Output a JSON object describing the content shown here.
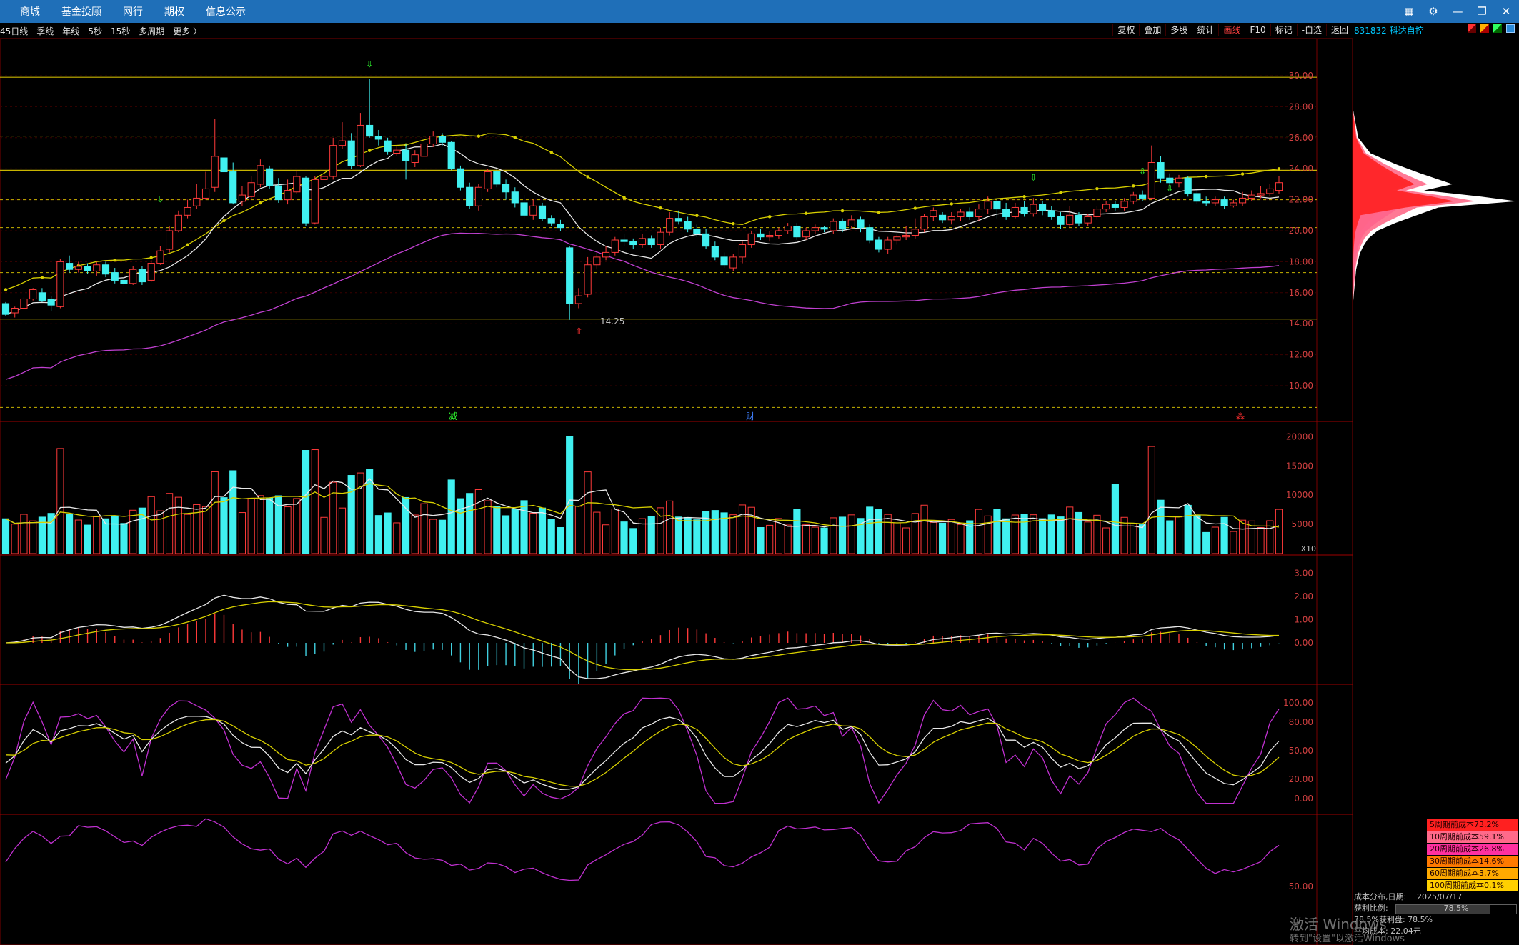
{
  "menu": [
    "商城",
    "基金投顾",
    "网行",
    "期权",
    "信息公示"
  ],
  "window_controls": [
    "▦",
    "⚙",
    "—",
    "❐",
    "✕"
  ],
  "periods": [
    "45日线",
    "季线",
    "年线",
    "5秒",
    "15秒",
    "多周期",
    "更多 〉"
  ],
  "tools": [
    "复权",
    "叠加",
    "多股",
    "统计",
    "画线",
    "F10",
    "标记",
    "-自选",
    "返回"
  ],
  "active_tool": "画线",
  "stock": {
    "label": "831832 科达自控"
  },
  "price_axis": {
    "ticks": [
      "30.00",
      "28.00",
      "26.00",
      "24.00",
      "22.00",
      "20.00",
      "18.00",
      "16.00",
      "14.00",
      "12.00",
      "10.00"
    ]
  },
  "low_label": "14.25",
  "event_markers": [
    {
      "text": "减"
    },
    {
      "text": "财"
    },
    {
      "text": "⁂"
    }
  ],
  "volume_axis": {
    "ticks": [
      "20000",
      "15000",
      "10000",
      "5000"
    ],
    "unit": "X10"
  },
  "macd_axis": {
    "ticks": [
      "3.00",
      "2.00",
      "1.00",
      "0.00"
    ]
  },
  "kdj_axis": {
    "ticks": [
      "100.00",
      "80.00",
      "50.00",
      "20.00",
      "0.00"
    ]
  },
  "wr_axis": {
    "ticks": [
      "50.00"
    ]
  },
  "cost_rows": [
    {
      "label": "5周期前成本73.2%",
      "color": "#ff2020"
    },
    {
      "label": "10周期前成本59.1%",
      "color": "#ff6a8a"
    },
    {
      "label": "20周期前成本26.8%",
      "color": "#ff30a0"
    },
    {
      "label": "30周期前成本14.6%",
      "color": "#ff7a00"
    },
    {
      "label": "60周期前成本3.7%",
      "color": "#ffaa00"
    },
    {
      "label": "100周期前成本0.1%",
      "color": "#ffd000"
    }
  ],
  "info": {
    "date_label": "成本分布,日期:",
    "date": "2025/07/17",
    "profit_label": "获利比例:",
    "profit_value": "78.5%",
    "profit_ratio": 0.785,
    "profit2_label": "78.5%获利盘:",
    "profit2_value": "78.5%",
    "avg_label": "平均成本:",
    "avg_value": "22.04元"
  },
  "watermark": {
    "line1": "激活 Windows",
    "line2": "转到\"设置\"以激活Windows"
  },
  "chart_data": {
    "type": "candlestick",
    "price_range": [
      8.5,
      31.5
    ],
    "h_levels_solid": [
      29.9,
      23.9,
      14.3
    ],
    "h_levels_dashed": [
      26.1,
      22.0,
      20.2,
      17.3,
      8.6
    ],
    "candles": [
      [
        15.3,
        14.6,
        15.4,
        14.5
      ],
      [
        14.7,
        15.0,
        15.1,
        14.4
      ],
      [
        15.0,
        15.6,
        15.7,
        14.9
      ],
      [
        15.6,
        16.2,
        16.3,
        15.5
      ],
      [
        16.0,
        15.5,
        16.3,
        15.4
      ],
      [
        15.6,
        15.2,
        15.8,
        14.8
      ],
      [
        15.1,
        18.0,
        18.2,
        15.0
      ],
      [
        17.9,
        17.5,
        18.4,
        17.3
      ],
      [
        17.5,
        17.7,
        18.0,
        17.3
      ],
      [
        17.7,
        17.4,
        17.9,
        17.2
      ],
      [
        17.4,
        17.8,
        18.0,
        17.1
      ],
      [
        17.8,
        17.2,
        18.0,
        17.0
      ],
      [
        17.3,
        16.8,
        17.6,
        16.6
      ],
      [
        16.8,
        16.6,
        17.0,
        16.4
      ],
      [
        16.6,
        17.5,
        17.7,
        16.5
      ],
      [
        17.5,
        16.7,
        17.7,
        16.5
      ],
      [
        16.8,
        17.9,
        18.1,
        16.7
      ],
      [
        17.9,
        18.7,
        19.0,
        17.8
      ],
      [
        18.8,
        20.0,
        20.3,
        18.6
      ],
      [
        20.0,
        21.0,
        21.3,
        19.9
      ],
      [
        21.0,
        21.5,
        22.0,
        20.8
      ],
      [
        21.6,
        22.1,
        23.0,
        21.4
      ],
      [
        22.1,
        22.7,
        23.8,
        22.0
      ],
      [
        22.8,
        24.8,
        27.2,
        22.5
      ],
      [
        24.7,
        23.8,
        25.0,
        23.4
      ],
      [
        23.8,
        21.8,
        24.4,
        21.7
      ],
      [
        21.9,
        22.3,
        22.9,
        21.6
      ],
      [
        22.2,
        23.1,
        23.5,
        22.0
      ],
      [
        23.0,
        24.2,
        24.6,
        22.8
      ],
      [
        24.0,
        22.9,
        24.2,
        22.7
      ],
      [
        22.9,
        22.0,
        23.4,
        21.8
      ],
      [
        22.0,
        22.6,
        23.3,
        21.7
      ],
      [
        22.5,
        23.5,
        23.9,
        22.4
      ],
      [
        23.4,
        20.5,
        23.5,
        20.3
      ],
      [
        20.5,
        23.3,
        23.5,
        20.4
      ],
      [
        23.3,
        23.5,
        23.8,
        22.8
      ],
      [
        23.5,
        25.5,
        26.0,
        23.3
      ],
      [
        25.5,
        25.8,
        27.0,
        25.3
      ],
      [
        25.8,
        24.2,
        26.3,
        24.0
      ],
      [
        24.2,
        26.8,
        27.6,
        24.1
      ],
      [
        26.8,
        26.1,
        29.8,
        26.0
      ],
      [
        26.1,
        25.9,
        26.5,
        25.5
      ],
      [
        25.8,
        25.1,
        26.0,
        24.9
      ],
      [
        25.0,
        25.2,
        25.5,
        24.8
      ],
      [
        25.2,
        24.5,
        25.6,
        23.3
      ],
      [
        24.4,
        24.9,
        25.2,
        24.1
      ],
      [
        24.8,
        25.6,
        25.9,
        24.6
      ],
      [
        25.6,
        26.1,
        26.4,
        25.4
      ],
      [
        26.1,
        25.7,
        26.3,
        25.5
      ],
      [
        25.7,
        24.0,
        25.8,
        23.9
      ],
      [
        24.0,
        22.8,
        24.2,
        22.6
      ],
      [
        22.8,
        21.6,
        23.1,
        21.4
      ],
      [
        21.6,
        22.8,
        23.0,
        21.3
      ],
      [
        22.7,
        23.8,
        24.0,
        22.5
      ],
      [
        23.8,
        23.0,
        24.0,
        22.8
      ],
      [
        23.0,
        22.5,
        23.3,
        22.0
      ],
      [
        22.5,
        21.8,
        22.8,
        21.5
      ],
      [
        21.8,
        21.0,
        22.3,
        20.8
      ],
      [
        21.0,
        21.6,
        22.0,
        20.7
      ],
      [
        21.6,
        20.8,
        21.8,
        20.6
      ],
      [
        20.8,
        20.5,
        21.0,
        20.3
      ],
      [
        20.4,
        20.2,
        20.7,
        20.0
      ],
      [
        18.9,
        15.3,
        19.0,
        14.25
      ],
      [
        15.3,
        15.8,
        16.3,
        15.0
      ],
      [
        15.9,
        17.8,
        18.3,
        15.7
      ],
      [
        17.8,
        18.3,
        18.6,
        17.5
      ],
      [
        18.3,
        18.6,
        19.0,
        18.1
      ],
      [
        18.6,
        19.4,
        19.6,
        18.4
      ],
      [
        19.4,
        19.3,
        19.8,
        19.0
      ],
      [
        19.3,
        19.1,
        19.5,
        18.8
      ],
      [
        19.1,
        19.5,
        19.8,
        18.9
      ],
      [
        19.5,
        19.1,
        19.7,
        18.9
      ],
      [
        19.1,
        19.9,
        20.2,
        18.8
      ],
      [
        19.9,
        20.8,
        21.2,
        19.7
      ],
      [
        20.8,
        20.6,
        21.3,
        20.4
      ],
      [
        20.6,
        20.1,
        20.9,
        19.9
      ],
      [
        20.1,
        19.8,
        20.4,
        19.6
      ],
      [
        19.8,
        19.0,
        20.1,
        18.8
      ],
      [
        19.0,
        18.3,
        19.3,
        18.1
      ],
      [
        18.3,
        17.8,
        18.6,
        17.6
      ],
      [
        17.6,
        18.3,
        18.5,
        17.4
      ],
      [
        18.3,
        19.1,
        19.3,
        17.9
      ],
      [
        19.1,
        19.8,
        20.0,
        18.9
      ],
      [
        19.8,
        19.6,
        20.1,
        19.4
      ],
      [
        19.6,
        19.7,
        20.0,
        19.3
      ],
      [
        19.7,
        20.0,
        20.2,
        19.5
      ],
      [
        20.0,
        20.3,
        20.5,
        19.8
      ],
      [
        20.3,
        19.6,
        20.5,
        19.4
      ],
      [
        19.6,
        20.0,
        20.2,
        19.4
      ],
      [
        20.0,
        20.2,
        20.4,
        19.8
      ],
      [
        20.2,
        20.1,
        20.3,
        19.9
      ],
      [
        20.0,
        20.6,
        20.8,
        19.8
      ],
      [
        20.6,
        20.1,
        20.8,
        19.9
      ],
      [
        20.3,
        20.7,
        21.0,
        20.1
      ],
      [
        20.7,
        20.2,
        20.9,
        19.9
      ],
      [
        20.2,
        19.4,
        20.4,
        19.2
      ],
      [
        19.4,
        18.8,
        19.6,
        18.6
      ],
      [
        18.8,
        19.4,
        19.6,
        18.5
      ],
      [
        19.4,
        19.6,
        19.8,
        19.1
      ],
      [
        19.6,
        19.7,
        20.3,
        19.4
      ],
      [
        19.7,
        20.1,
        20.8,
        19.5
      ],
      [
        20.1,
        20.9,
        21.1,
        19.9
      ],
      [
        20.9,
        21.3,
        21.5,
        20.6
      ],
      [
        21.0,
        20.7,
        21.2,
        20.5
      ],
      [
        20.7,
        20.9,
        21.2,
        20.4
      ],
      [
        20.9,
        21.2,
        21.4,
        20.6
      ],
      [
        21.2,
        20.9,
        21.5,
        20.7
      ],
      [
        20.9,
        21.4,
        21.7,
        20.6
      ],
      [
        21.4,
        21.9,
        22.2,
        21.1
      ],
      [
        21.9,
        21.4,
        22.1,
        20.8
      ],
      [
        21.4,
        20.9,
        21.8,
        20.7
      ],
      [
        20.9,
        21.5,
        21.8,
        20.8
      ],
      [
        21.5,
        21.1,
        21.9,
        20.9
      ],
      [
        21.1,
        21.7,
        22.1,
        20.9
      ],
      [
        21.7,
        21.3,
        21.9,
        21.0
      ],
      [
        21.3,
        20.9,
        21.6,
        20.7
      ],
      [
        20.9,
        20.4,
        21.2,
        20.1
      ],
      [
        20.4,
        21.0,
        21.6,
        20.2
      ],
      [
        21.0,
        20.5,
        21.2,
        20.3
      ],
      [
        20.5,
        20.9,
        21.1,
        20.3
      ],
      [
        20.9,
        21.4,
        21.6,
        20.7
      ],
      [
        21.4,
        21.7,
        21.9,
        21.2
      ],
      [
        21.7,
        21.5,
        21.9,
        21.3
      ],
      [
        21.5,
        21.9,
        22.1,
        21.3
      ],
      [
        21.9,
        22.3,
        22.5,
        21.7
      ],
      [
        22.3,
        22.1,
        22.6,
        21.9
      ],
      [
        22.1,
        24.4,
        25.5,
        22.0
      ],
      [
        24.4,
        23.4,
        24.8,
        23.1
      ],
      [
        23.4,
        23.1,
        23.7,
        22.9
      ],
      [
        23.1,
        23.4,
        23.6,
        22.8
      ],
      [
        23.4,
        22.4,
        23.5,
        22.2
      ],
      [
        22.4,
        21.9,
        22.6,
        21.7
      ],
      [
        21.9,
        21.8,
        22.2,
        21.6
      ],
      [
        21.8,
        22.0,
        22.2,
        21.6
      ],
      [
        22.0,
        21.6,
        22.2,
        21.4
      ],
      [
        21.6,
        21.8,
        22.0,
        21.5
      ],
      [
        21.8,
        22.1,
        22.5,
        21.6
      ],
      [
        22.1,
        22.3,
        22.6,
        21.9
      ],
      [
        22.3,
        22.4,
        22.9,
        22.1
      ],
      [
        22.4,
        22.7,
        23.0,
        22.2
      ],
      [
        22.6,
        23.1,
        23.5,
        22.4
      ]
    ]
  }
}
